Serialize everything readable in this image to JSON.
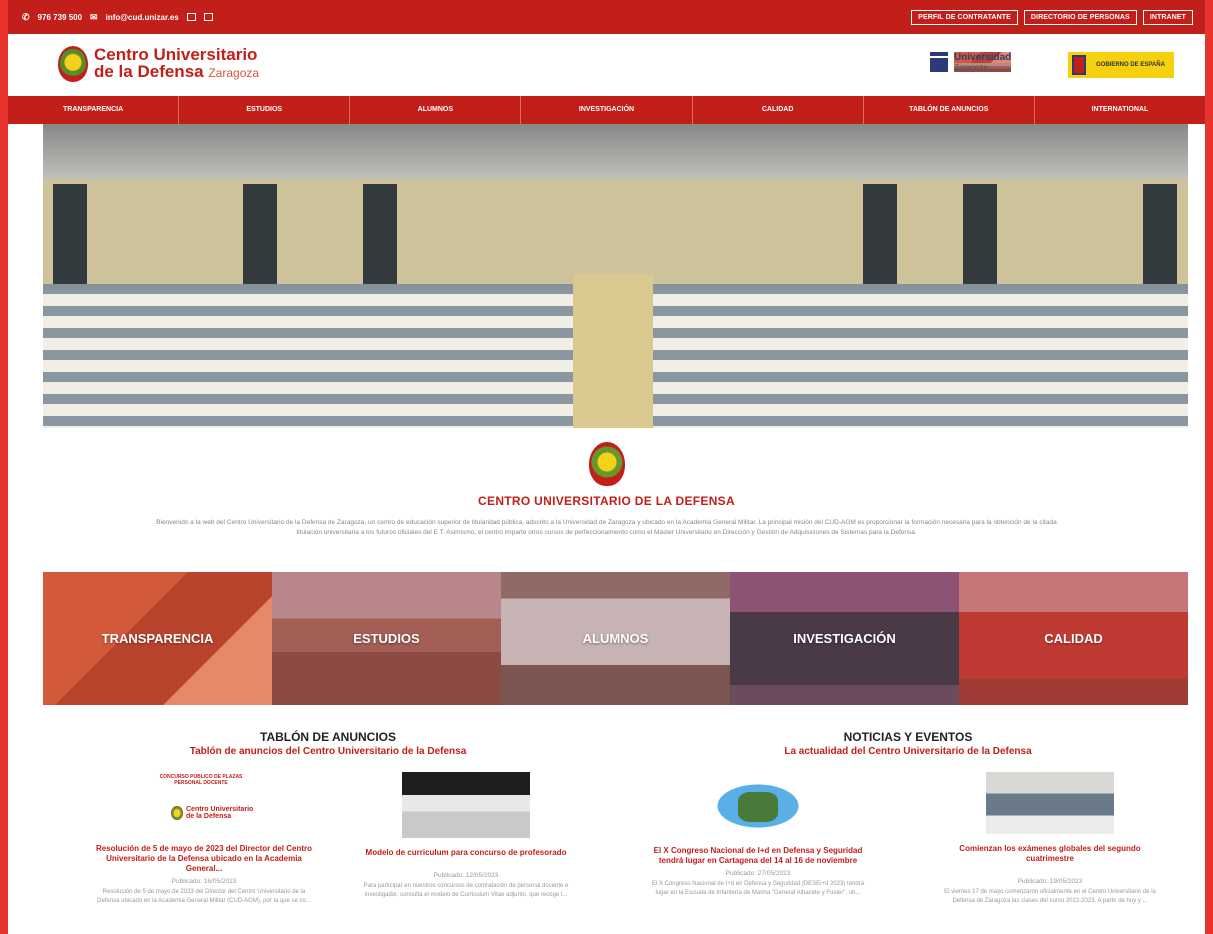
{
  "topbar": {
    "phone": "976 739 500",
    "email": "info@cud.unizar.es",
    "links": [
      "PERFIL DE CONTRATANTE",
      "DIRECTORIO DE PERSONAS",
      "INTRANET"
    ]
  },
  "header": {
    "brand_line1": "Centro Universitario",
    "brand_line2": "de la Defensa",
    "brand_city": "Zaragoza",
    "uz_name": "Universidad",
    "uz_city": "Zaragoza",
    "gob_text": "GOBIERNO DE ESPAÑA"
  },
  "nav": [
    "TRANSPARENCIA",
    "ESTUDIOS",
    "ALUMNOS",
    "INVESTIGACIÓN",
    "CALIDAD",
    "TABLÓN DE ANUNCIOS",
    "INTERNATIONAL"
  ],
  "intro": {
    "title": "CENTRO UNIVERSITARIO DE LA DEFENSA",
    "text": "Bienvenido a la web del Centro Universitario de la Defensa de Zaragoza, un centro de educación superior de titularidad pública, adscrito a la Universidad de Zaragoza y ubicado en la Academia General Militar. La principal misión del CUD-AGM es proporcionar la formación necesaria para la obtención de la citada titulación universitaria a los futuros oficiales del E.T. Asimismo, el centro imparte otros cursos de perfeccionamiento como el Máster Universitario en Dirección y Gestión de Adquisiciones de Sistemas para la Defensa."
  },
  "tiles": [
    "TRANSPARENCIA",
    "ESTUDIOS",
    "ALUMNOS",
    "INVESTIGACIÓN",
    "CALIDAD"
  ],
  "tablon": {
    "title": "TABLÓN DE ANUNCIOS",
    "subtitle": "Tablón de anuncios del Centro Universitario de la Defensa",
    "cards": [
      {
        "thumb_top": "CONCURSO PÚBLICO DE PLAZAS PERSONAL DOCENTE",
        "thumb_brand1": "Centro Universitario",
        "thumb_brand2": "de la Defensa",
        "title": "Resolución de 5 de mayo de 2023 del Director del Centro Universitario de la Defensa ubicado en la Academia General...",
        "published": "Publicado: 16/05/2023",
        "excerpt": "Resolución de 5 de mayo de 2023 del Director del Centro Universitario de la Defensa ubicado en la Academia General Militar (CUD-AGM), por la que se co..."
      },
      {
        "title": "Modelo de curriculum para concurso de profesorado",
        "published": "Publicado: 12/05/2023",
        "excerpt": "Para participar en nuestros concursos de contratación de personal docente e investigador, consulta el modelo de Curriculum Vitae adjunto, que recoge l..."
      }
    ]
  },
  "noticias": {
    "title": "NOTICIAS Y EVENTOS",
    "subtitle": "La actualidad del Centro Universitario de la Defensa",
    "cards": [
      {
        "title": "El X Congreso Nacional de I+d en Defensa y Seguridad tendrá lugar en Cartagena del 14 al 16 de noviembre",
        "published": "Publicado: 27/05/2023",
        "excerpt": "El X Congreso Nacional de I+d en Defensa y Seguridad (DESEi+d 2023) tendrá lugar en la Escuela de Infantería de Marina \"General Albacete y Fuster\", ub..."
      },
      {
        "title": "Comienzan los exámenes globales del segundo cuatrimestre",
        "published": "Publicado: 19/05/2023",
        "excerpt": "El viernes 17 de mayo comenzaron oficialmente en el Centro Universitario de la Defensa de Zaragoza las clases del curso 2022-2023. A partir de hoy y ..."
      }
    ]
  }
}
